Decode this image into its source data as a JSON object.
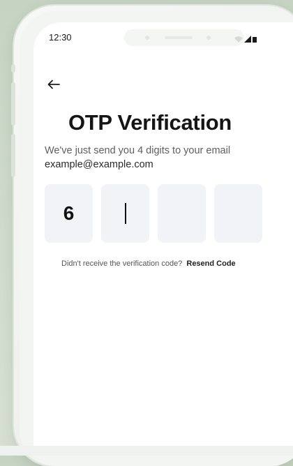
{
  "status_bar": {
    "time": "12:30",
    "icons": [
      "wifi-icon",
      "signal-icon",
      "battery-icon"
    ]
  },
  "header": {
    "back_icon": "arrow-left-icon"
  },
  "main": {
    "title": "OTP Verification",
    "description": "We've just send you 4 digits to your email",
    "email": "example@example.com",
    "otp": {
      "digits": [
        "6",
        "",
        "",
        ""
      ],
      "active_index": 1
    },
    "resend": {
      "prompt": "Didn't receive the verification code?",
      "link_label": "Resend Code"
    }
  },
  "colors": {
    "background": "#cfdacc",
    "screen": "#ffffff",
    "otp_box": "#f2f3f6",
    "title_text": "#151515",
    "body_text": "#5e5e5e"
  }
}
